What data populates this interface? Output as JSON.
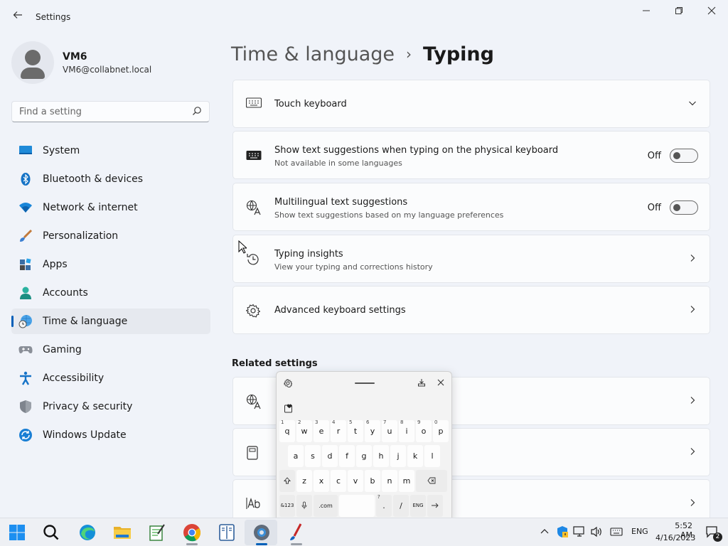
{
  "window": {
    "title": "Settings",
    "back_icon": "back-arrow-icon",
    "controls": [
      "minimize-icon",
      "maximize-icon",
      "close-icon"
    ]
  },
  "profile": {
    "name": "VM6",
    "email": "VM6@collabnet.local"
  },
  "search": {
    "placeholder": "Find a setting"
  },
  "sidebar": {
    "items": [
      {
        "label": "System",
        "icon": "system-icon"
      },
      {
        "label": "Bluetooth & devices",
        "icon": "bluetooth-icon"
      },
      {
        "label": "Network & internet",
        "icon": "wifi-icon"
      },
      {
        "label": "Personalization",
        "icon": "brush-icon"
      },
      {
        "label": "Apps",
        "icon": "apps-icon"
      },
      {
        "label": "Accounts",
        "icon": "accounts-icon"
      },
      {
        "label": "Time & language",
        "icon": "time-language-icon",
        "active": true
      },
      {
        "label": "Gaming",
        "icon": "gamepad-icon"
      },
      {
        "label": "Accessibility",
        "icon": "accessibility-icon"
      },
      {
        "label": "Privacy & security",
        "icon": "shield-icon"
      },
      {
        "label": "Windows Update",
        "icon": "windows-update-icon"
      }
    ]
  },
  "header": {
    "parent": "Time & language",
    "separator": "›",
    "current": "Typing"
  },
  "cards": {
    "touch_keyboard": {
      "title": "Touch keyboard"
    },
    "text_suggestions": {
      "title": "Show text suggestions when typing on the physical keyboard",
      "subtitle": "Not available in some languages",
      "state": "Off"
    },
    "multilingual": {
      "title": "Multilingual text suggestions",
      "subtitle": "Show text suggestions based on my language preferences",
      "state": "Off"
    },
    "insights": {
      "title": "Typing insights",
      "subtitle": "View your typing and corrections history"
    },
    "advanced": {
      "title": "Advanced keyboard settings"
    }
  },
  "related": {
    "title": "Related settings"
  },
  "keyboard": {
    "row1": [
      {
        "k": "q",
        "n": "1"
      },
      {
        "k": "w",
        "n": "2"
      },
      {
        "k": "e",
        "n": "3"
      },
      {
        "k": "r",
        "n": "4"
      },
      {
        "k": "t",
        "n": "5"
      },
      {
        "k": "y",
        "n": "6"
      },
      {
        "k": "u",
        "n": "7"
      },
      {
        "k": "i",
        "n": "8"
      },
      {
        "k": "o",
        "n": "9"
      },
      {
        "k": "p",
        "n": "0"
      }
    ],
    "row2": [
      "a",
      "s",
      "d",
      "f",
      "g",
      "h",
      "j",
      "k",
      "l"
    ],
    "row3": [
      "z",
      "x",
      "c",
      "v",
      "b",
      "n",
      "m"
    ],
    "row4": {
      "sym": "&123",
      "com": ".com",
      "dot": ".",
      "q": "?",
      "slash": "/",
      "lang": "ENG"
    }
  },
  "taskbar": {
    "apps": [
      "start-icon",
      "search-icon",
      "edge-icon",
      "file-explorer-icon",
      "notepad-icon",
      "chrome-icon",
      "reader-icon",
      "settings-gear-icon",
      "paint-icon"
    ],
    "language": "ENG",
    "time": "5:52 AM",
    "date": "4/16/2023",
    "notifications": "2"
  },
  "colors": {
    "accent": "#005fb8",
    "background": "#f0f3f9",
    "card": "#fbfcfd"
  }
}
